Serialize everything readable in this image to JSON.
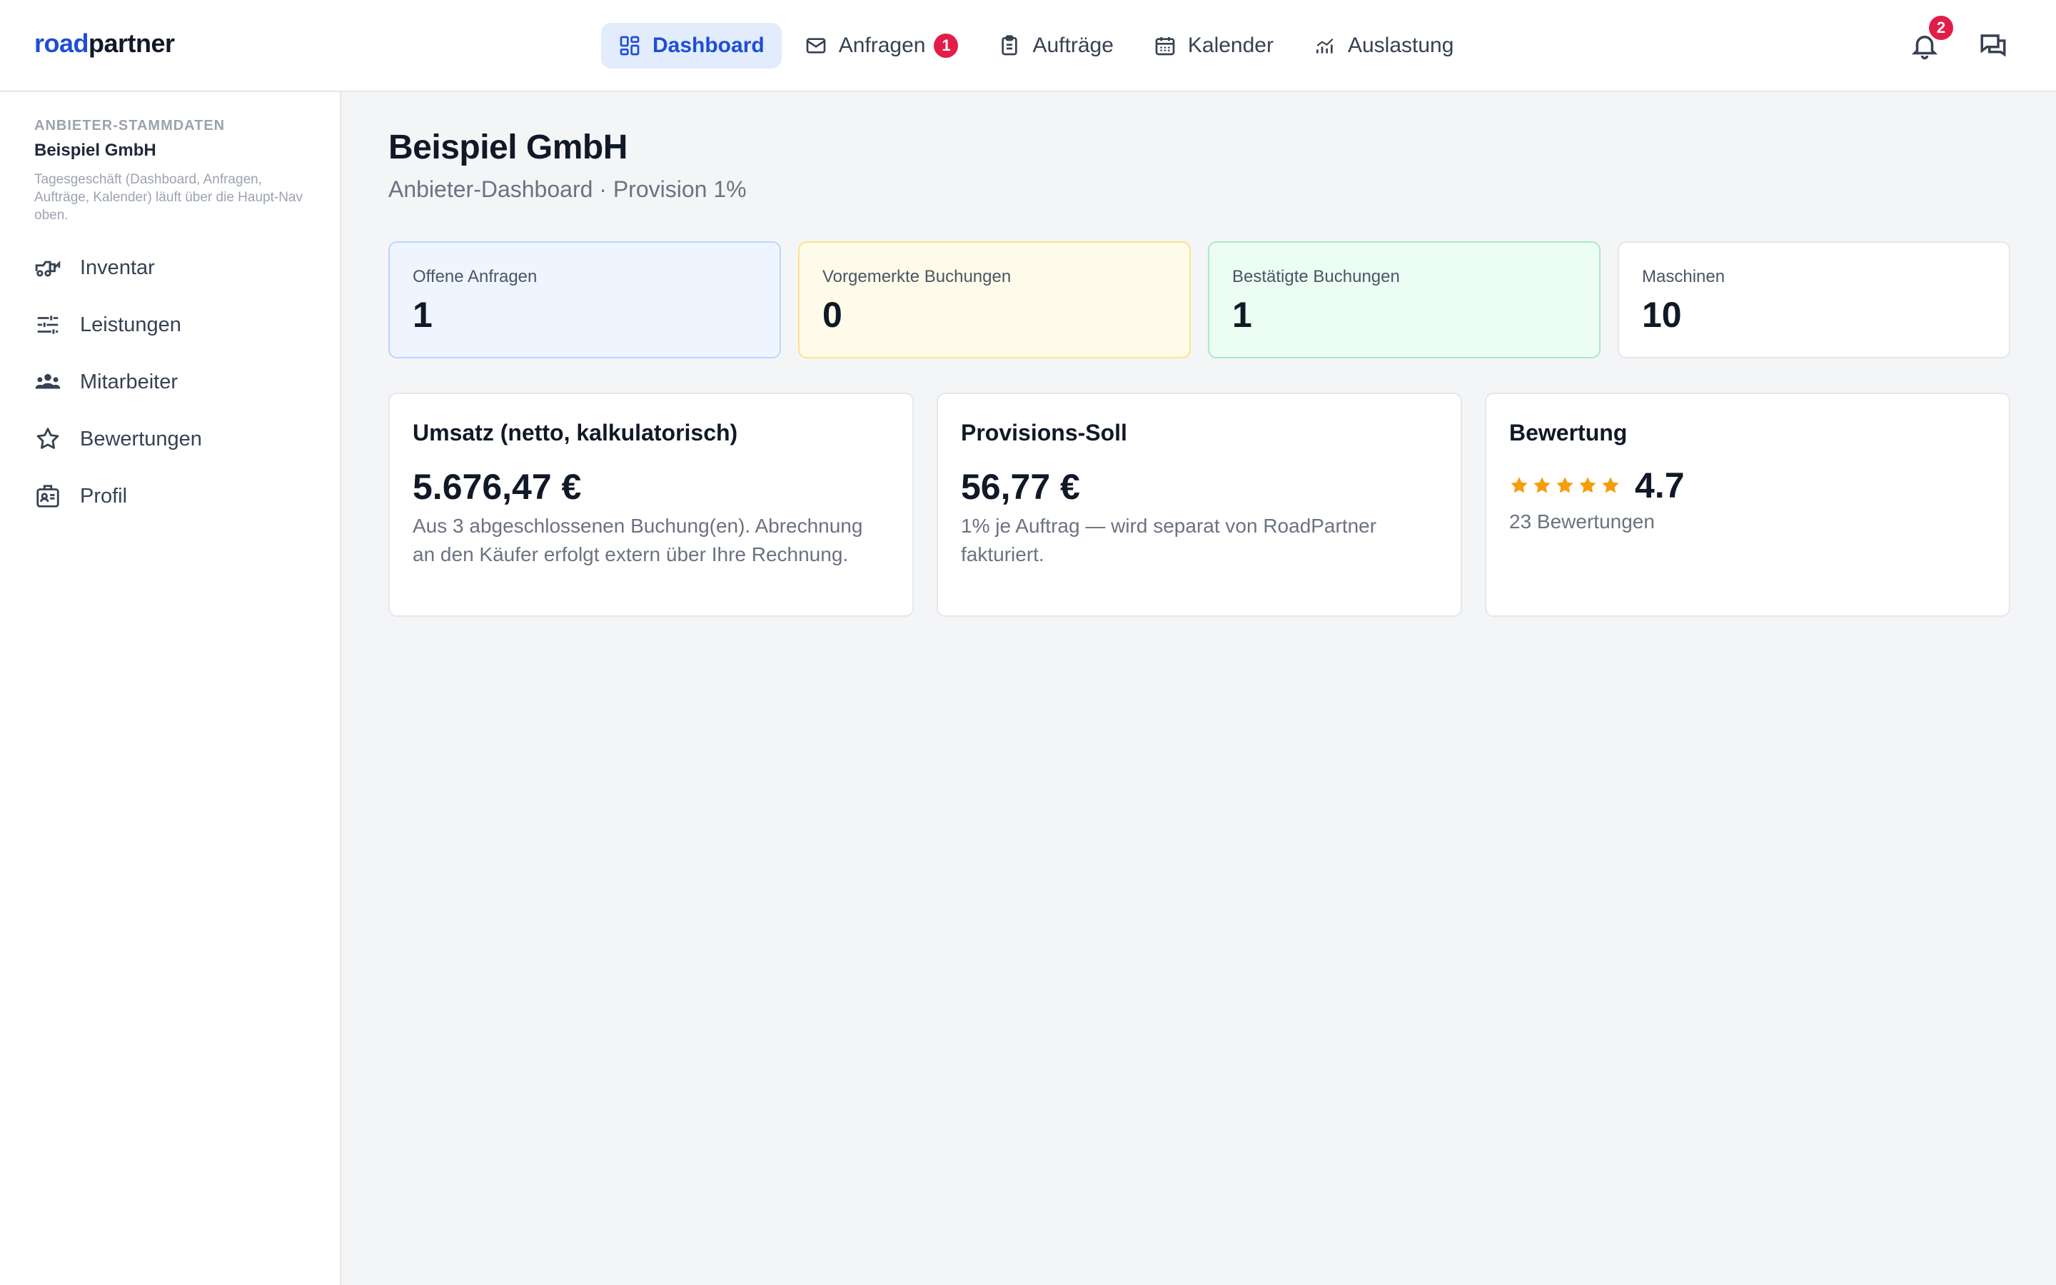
{
  "brand": {
    "part1": "road",
    "part2": "partner"
  },
  "nav": {
    "dashboard": "Dashboard",
    "anfragen": "Anfragen",
    "anfragen_badge": "1",
    "auftraege": "Aufträge",
    "kalender": "Kalender",
    "auslastung": "Auslastung"
  },
  "header": {
    "notifications_badge": "2"
  },
  "sidebar": {
    "section_label": "ANBIETER-STAMMDATEN",
    "company": "Beispiel GmbH",
    "note": "Tagesgeschäft (Dashboard, Anfragen, Aufträge, Kalender) läuft über die Haupt-Nav oben.",
    "items": [
      {
        "label": "Inventar",
        "icon": "truck-icon"
      },
      {
        "label": "Leistungen",
        "icon": "sliders-icon"
      },
      {
        "label": "Mitarbeiter",
        "icon": "team-icon"
      },
      {
        "label": "Bewertungen",
        "icon": "star-icon"
      },
      {
        "label": "Profil",
        "icon": "id-card-icon"
      }
    ]
  },
  "page": {
    "title": "Beispiel GmbH",
    "subtitle": "Anbieter-Dashboard · Provision 1%"
  },
  "stats": [
    {
      "label": "Offene Anfragen",
      "value": "1"
    },
    {
      "label": "Vorgemerkte Buchungen",
      "value": "0"
    },
    {
      "label": "Bestätigte Buchungen",
      "value": "1"
    },
    {
      "label": "Maschinen",
      "value": "10"
    }
  ],
  "cards": {
    "umsatz": {
      "title": "Umsatz (netto, kalkulatorisch)",
      "value": "5.676,47 €",
      "desc": "Aus 3 abgeschlossenen Buchung(en). Abrechnung an den Käufer erfolgt extern über Ihre Rechnung."
    },
    "provision": {
      "title": "Provisions-Soll",
      "value": "56,77 €",
      "desc": "1% je Auftrag — wird separat von RoadPartner fakturiert."
    },
    "bewertung": {
      "title": "Bewertung",
      "value": "4.7",
      "stars": 5,
      "desc": "23 Bewertungen"
    }
  },
  "colors": {
    "accent": "#1d4ed8",
    "badge": "#e11d48",
    "star": "#f59e0b"
  }
}
